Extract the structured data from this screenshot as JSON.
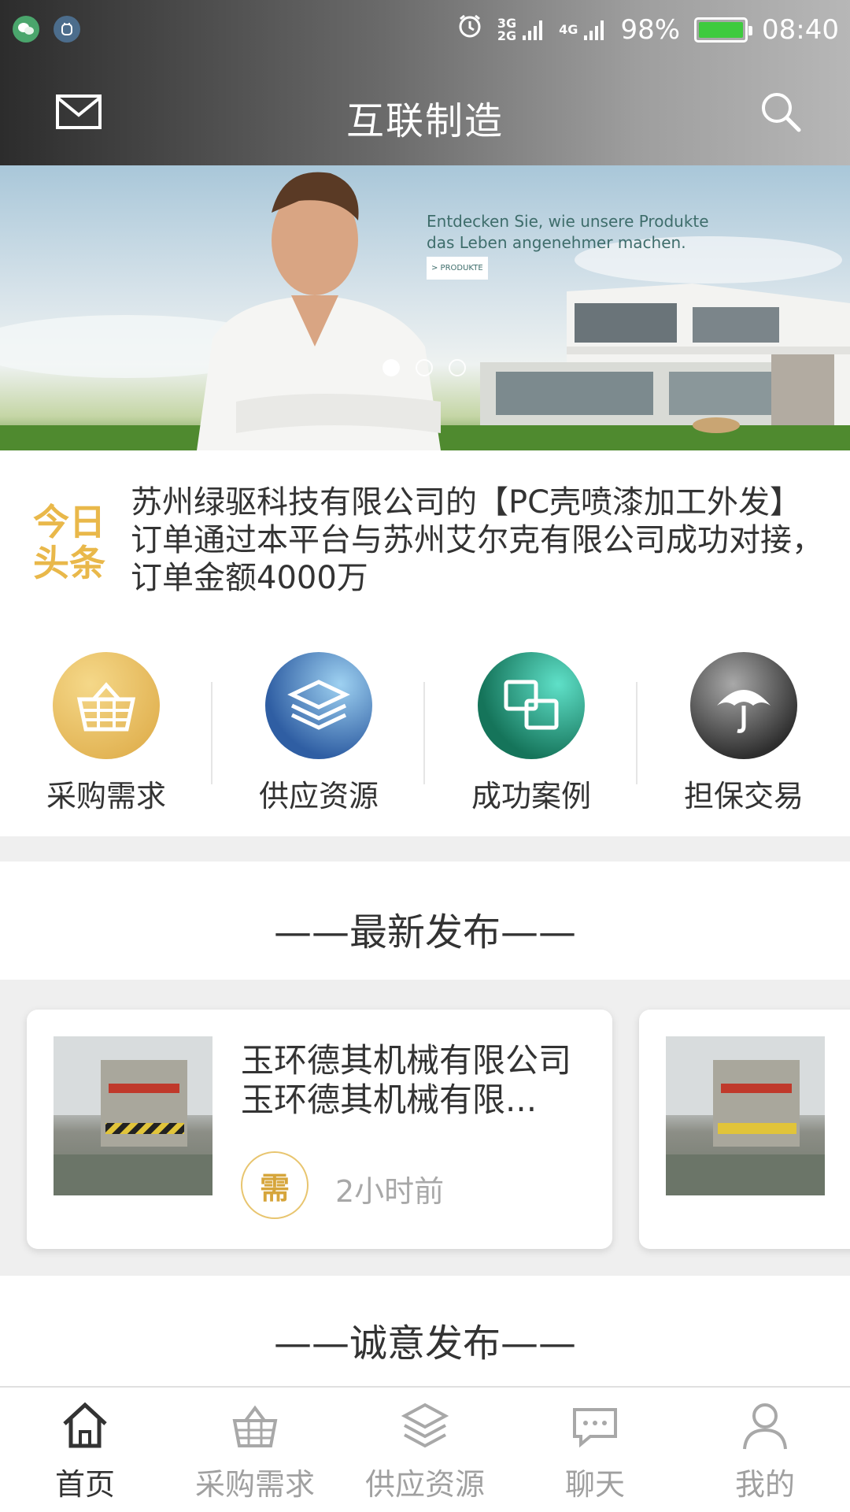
{
  "status_bar": {
    "battery": "98%",
    "time": "08:40",
    "network_primary": "3G\n2G",
    "network_secondary": "4G"
  },
  "header": {
    "title": "互联制造"
  },
  "banner": {
    "line1": "Entdecken Sie, wie unsere Produkte",
    "line2": "das Leben angenehmer machen.",
    "tag": "> PRODUKTE",
    "active_slide": 1,
    "slide_count": 3
  },
  "headline": {
    "logo_line1": "今日",
    "logo_line2": "头条",
    "text": "苏州绿驱科技有限公司的【PC壳喷漆加工外发】订单通过本平台与苏州艾尔克有限公司成功对接，订单金额4000万"
  },
  "shortcuts": [
    {
      "label": "采购需求",
      "icon": "basket-icon",
      "color": "#e6b84d"
    },
    {
      "label": "供应资源",
      "icon": "layers-icon",
      "color": "#3f6fb0"
    },
    {
      "label": "成功案例",
      "icon": "linked-squares-icon",
      "color": "#1f8f6a"
    },
    {
      "label": "担保交易",
      "icon": "umbrella-icon",
      "color": "#555555"
    }
  ],
  "latest": {
    "title": "——最新发布——",
    "cards": [
      {
        "name": "玉环德其机械有限公司玉环德其机械有限...",
        "badge": "需",
        "time": "2小时前"
      },
      {
        "name": "",
        "badge": "",
        "time": ""
      }
    ]
  },
  "sincere": {
    "title": "——诚意发布——"
  },
  "tabbar": [
    {
      "label": "首页",
      "icon": "home-icon",
      "active": true
    },
    {
      "label": "采购需求",
      "icon": "basket-icon",
      "active": false
    },
    {
      "label": "供应资源",
      "icon": "layers-icon",
      "active": false
    },
    {
      "label": "聊天",
      "icon": "chat-icon",
      "active": false
    },
    {
      "label": "我的",
      "icon": "user-icon",
      "active": false
    }
  ]
}
